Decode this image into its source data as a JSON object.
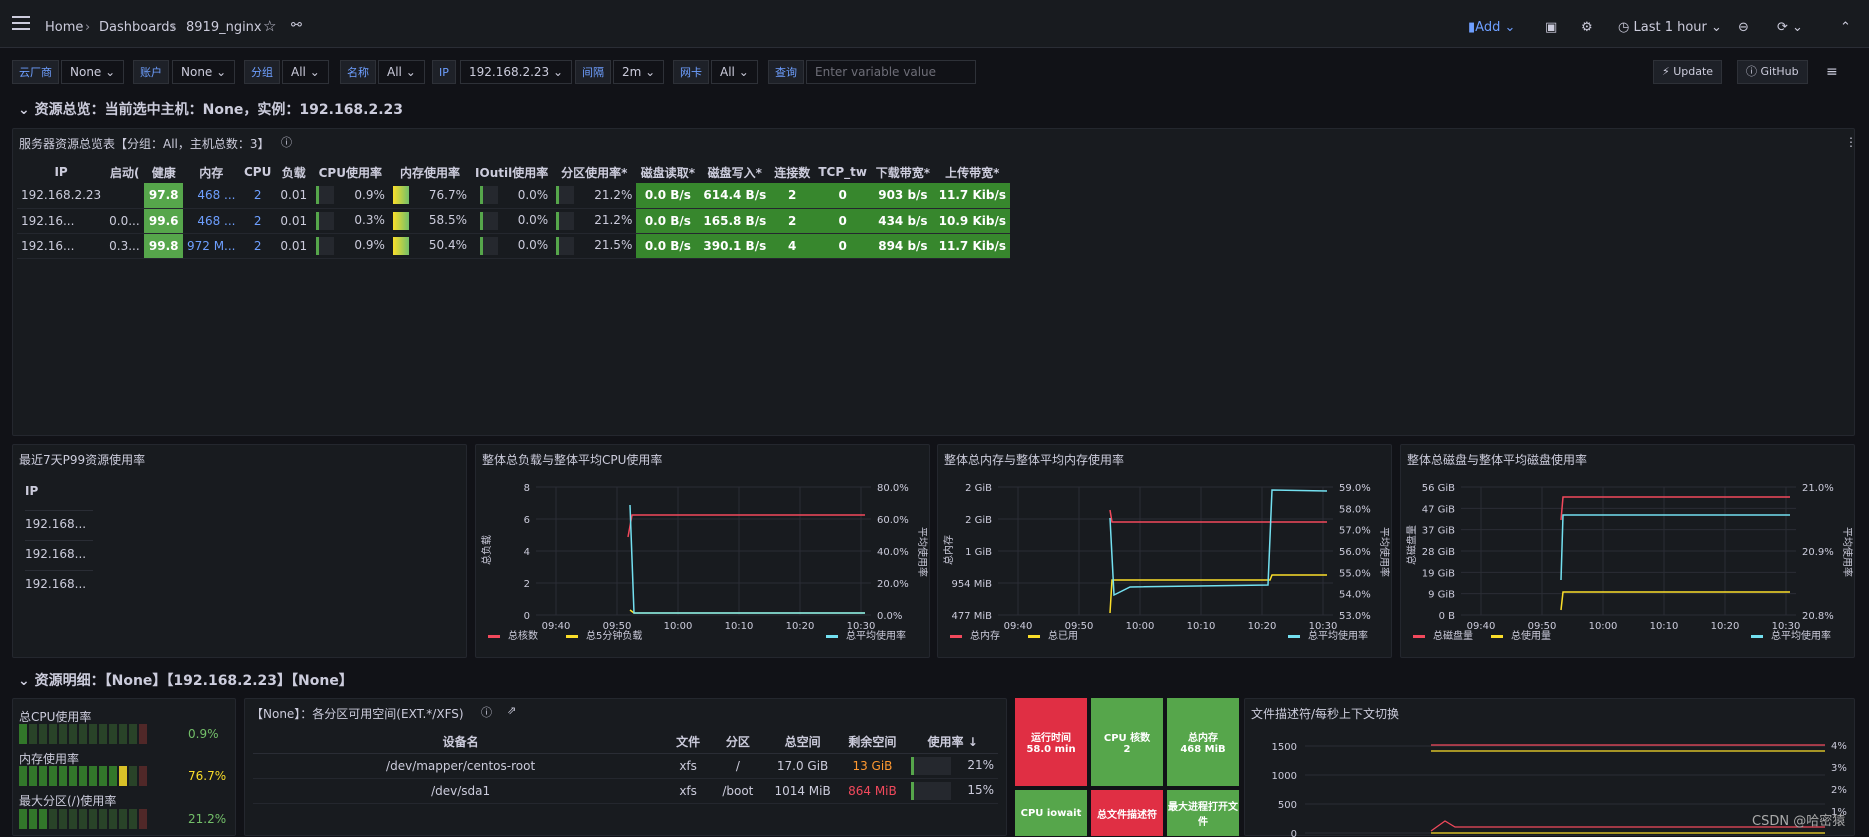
{
  "breadcrumb": {
    "home": "Home",
    "dashboards": "Dashboards",
    "current": "8919_nginx"
  },
  "toolbar": {
    "add": "Add",
    "time": "Last 1 hour"
  },
  "vars": [
    {
      "label": "云厂商",
      "value": "None"
    },
    {
      "label": "账户",
      "value": "None"
    },
    {
      "label": "分组",
      "value": "All"
    },
    {
      "label": "名称",
      "value": "All"
    },
    {
      "label": "IP",
      "value": "192.168.2.23"
    },
    {
      "label": "间隔",
      "value": "2m"
    },
    {
      "label": "网卡",
      "value": "All"
    },
    {
      "label": "查询",
      "value": "Enter variable value"
    }
  ],
  "buttons": {
    "update": "Update",
    "github": "GitHub"
  },
  "row1": "资源总览：当前选中主机：None，实例：192.168.2.23",
  "overview": {
    "title": "服务器资源总览表【分组：All，主机总数：3】",
    "headers": [
      "IP",
      "启动(",
      "健康",
      "内存",
      "CPU",
      "负载",
      "CPU使用率",
      "内存使用率",
      "IOutil使用率",
      "分区使用率*",
      "磁盘读取*",
      "磁盘写入*",
      "连接数",
      "TCP_tw",
      "下载带宽*",
      "上传带宽*"
    ],
    "rows": [
      [
        "192.168.2.23",
        "",
        "97.8",
        "468 ...",
        "2",
        "0.01",
        "0.9%",
        "76.7%",
        "0.0%",
        "21.2%",
        "0.0 B/s",
        "614.4 B/s",
        "2",
        "0",
        "903 b/s",
        "11.7 Kib/s"
      ],
      [
        "192.16...",
        "0.0...",
        "99.6",
        "468 ...",
        "2",
        "0.01",
        "0.3%",
        "58.5%",
        "0.0%",
        "21.2%",
        "0.0 B/s",
        "165.8 B/s",
        "2",
        "0",
        "434 b/s",
        "10.9 Kib/s"
      ],
      [
        "192.16...",
        "0.3...",
        "99.8",
        "972 M...",
        "2",
        "0.01",
        "0.9%",
        "50.4%",
        "0.0%",
        "21.5%",
        "0.0 B/s",
        "390.1 B/s",
        "4",
        "0",
        "894 b/s",
        "11.7 Kib/s"
      ]
    ]
  },
  "p99": {
    "title": "最近7天P99资源使用率",
    "header": "IP",
    "rows": [
      "192.168...",
      "192.168...",
      "192.168..."
    ]
  },
  "chart_data": [
    {
      "type": "line",
      "title": "整体总负载与整体平均CPU使用率",
      "ylabel": "总负载",
      "y2label": "平均使用率",
      "x": [
        "09:40",
        "09:50",
        "10:00",
        "10:10",
        "10:20",
        "10:30"
      ],
      "yticks": [
        "0",
        "2",
        "4",
        "6",
        "8"
      ],
      "y2ticks": [
        "0.0%",
        "20.0%",
        "40.0%",
        "60.0%",
        "80.0%"
      ],
      "series": [
        {
          "name": "总核数",
          "color": "#f2495c",
          "values": [
            null,
            6,
            6,
            6,
            6,
            6
          ]
        },
        {
          "name": "总5分钟负载",
          "color": "#fade2a",
          "values": [
            null,
            0.1,
            0.05,
            0.05,
            0.05,
            0.05
          ]
        },
        {
          "name": "总平均使用率",
          "color": "#73e0f0",
          "values": [
            null,
            6.5,
            0.1,
            0.1,
            0.1,
            0.1
          ]
        }
      ]
    },
    {
      "type": "line",
      "title": "整体总内存与整体平均内存使用率",
      "ylabel": "总内存",
      "y2label": "平均使用率",
      "x": [
        "09:40",
        "09:50",
        "10:00",
        "10:10",
        "10:20",
        "10:30"
      ],
      "yticks": [
        "477 MiB",
        "954 MiB",
        "1 GiB",
        "2 GiB",
        "2 GiB"
      ],
      "y2ticks": [
        "53.0%",
        "54.0%",
        "55.0%",
        "56.0%",
        "57.0%",
        "58.0%",
        "59.0%"
      ],
      "series": [
        {
          "name": "总内存",
          "color": "#f2495c"
        },
        {
          "name": "总已用",
          "color": "#fade2a"
        },
        {
          "name": "总平均使用率",
          "color": "#73e0f0"
        }
      ]
    },
    {
      "type": "line",
      "title": "整体总磁盘与整体平均磁盘使用率",
      "ylabel": "总磁盘量",
      "y2label": "平均使用率",
      "x": [
        "09:40",
        "09:50",
        "10:00",
        "10:10",
        "10:20",
        "10:30"
      ],
      "yticks": [
        "0 B",
        "9 GiB",
        "19 GiB",
        "28 GiB",
        "37 GiB",
        "47 GiB",
        "56 GiB"
      ],
      "y2ticks": [
        "20.8%",
        "20.9%",
        "21.0%"
      ],
      "series": [
        {
          "name": "总磁盘量",
          "color": "#f2495c"
        },
        {
          "name": "总使用量",
          "color": "#fade2a"
        },
        {
          "name": "总平均使用率",
          "color": "#73e0f0"
        }
      ]
    }
  ],
  "row2": "资源明细：【None】【192.168.2.23】【None】",
  "mini": [
    {
      "label": "总CPU使用率",
      "value": "0.9%"
    },
    {
      "label": "内存使用率",
      "value": "76.7%"
    },
    {
      "label": "最大分区(/)使用率",
      "value": "21.2%"
    }
  ],
  "parts": {
    "title": "【None】：各分区可用空间(EXT.*/XFS)",
    "headers": [
      "设备名",
      "文件",
      "分区",
      "总空间",
      "剩余空间",
      "使用率 ↓"
    ],
    "rows": [
      [
        "/dev/mapper/centos-root",
        "xfs",
        "/",
        "17.0 GiB",
        "13 GiB",
        "21%"
      ],
      [
        "/dev/sda1",
        "xfs",
        "/boot",
        "1014 MiB",
        "864 MiB",
        "15%"
      ]
    ]
  },
  "tiles": [
    {
      "label": "运行时间",
      "value": "58.0 min",
      "color": "#e02f44"
    },
    {
      "label": "CPU 核数",
      "value": "2",
      "color": "#56a64b"
    },
    {
      "label": "总内存",
      "value": "468 MiB",
      "color": "#56a64b"
    },
    {
      "label": "CPU iowait",
      "value": "",
      "color": "#56a64b"
    },
    {
      "label": "总文件描述符",
      "value": "",
      "color": "#e02f44"
    },
    {
      "label": "最大进程打开文件",
      "value": "",
      "color": "#56a64b"
    }
  ],
  "fd": {
    "title": "文件描述符/每秒上下文切换",
    "yticks": [
      "0",
      "500",
      "1000",
      "1500"
    ],
    "y2ticks": [
      "1%",
      "2%",
      "3%",
      "4%"
    ]
  },
  "watermark": "CSDN @哈密猿"
}
